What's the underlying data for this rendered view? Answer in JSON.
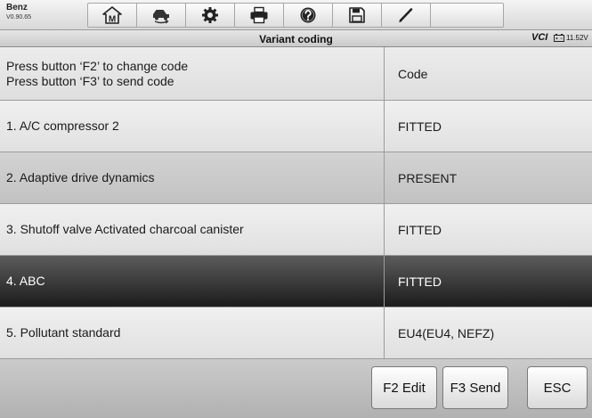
{
  "vehicle": {
    "make": "Benz",
    "version": "V0.90.65"
  },
  "toolbar": {
    "home_letter": "M",
    "buttons": [
      {
        "icon": "home-icon"
      },
      {
        "icon": "vehicle-swap-icon"
      },
      {
        "icon": "gear-icon"
      },
      {
        "icon": "printer-icon"
      },
      {
        "icon": "help-icon"
      },
      {
        "icon": "save-icon"
      },
      {
        "icon": "pencil-icon"
      }
    ]
  },
  "title": "Variant coding",
  "status": {
    "vci": "VCI",
    "battery_voltage": "11.52V",
    "battery_icon": "battery-icon"
  },
  "table": {
    "instructions": [
      "Press button ‘F2’ to change code",
      "Press button ‘F3’ to send code"
    ],
    "value_header": "Code",
    "rows": [
      {
        "label": "1. A/C compressor 2",
        "value": "FITTED"
      },
      {
        "label": "2. Adaptive drive dynamics",
        "value": "PRESENT"
      },
      {
        "label": "3. Shutoff valve Activated charcoal canister",
        "value": "FITTED"
      },
      {
        "label": "4. ABC",
        "value": "FITTED",
        "selected": true
      },
      {
        "label": "5. Pollutant standard",
        "value": "EU4(EU4, NEFZ)"
      }
    ]
  },
  "actions": {
    "edit": "F2 Edit",
    "send": "F3 Send",
    "esc": "ESC"
  },
  "colors": {
    "selected_row_bg": "#2a2a2a",
    "selected_row_text": "#ffffff",
    "row_bg": "#e8e8e8",
    "alt_row_bg": "#c8c8c8",
    "action_bar_bg": "#bdbdbd"
  }
}
